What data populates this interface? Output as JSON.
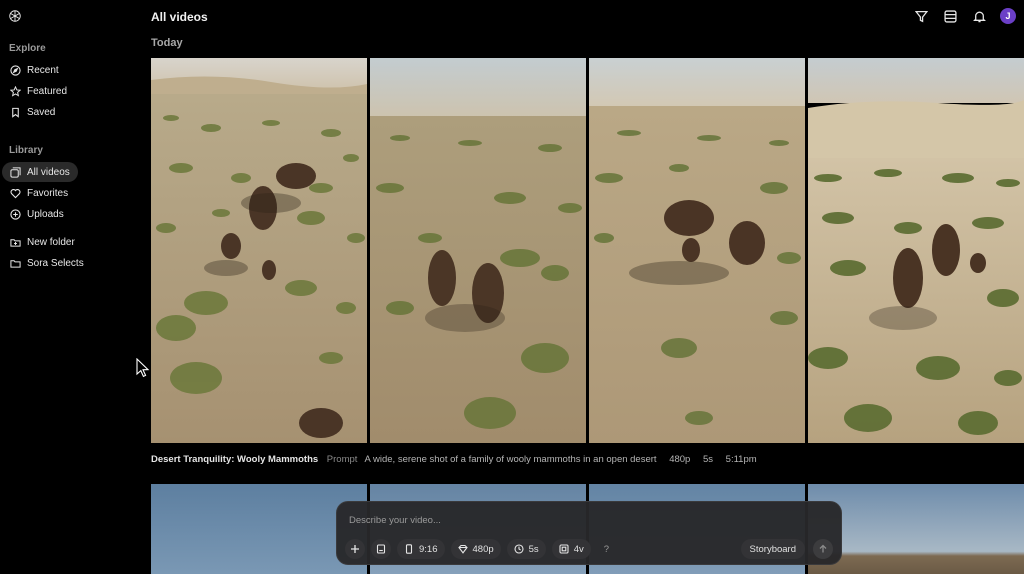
{
  "sidebar": {
    "explore_title": "Explore",
    "library_title": "Library",
    "explore_items": [
      {
        "label": "Recent",
        "icon": "compass-icon"
      },
      {
        "label": "Featured",
        "icon": "star-icon"
      },
      {
        "label": "Saved",
        "icon": "bookmark-icon"
      }
    ],
    "library_items": [
      {
        "label": "All videos",
        "icon": "videos-icon",
        "active": true
      },
      {
        "label": "Favorites",
        "icon": "heart-icon"
      },
      {
        "label": "Uploads",
        "icon": "upload-icon"
      }
    ],
    "folder_items": [
      {
        "label": "New folder",
        "icon": "new-folder-icon"
      },
      {
        "label": "Sora Selects",
        "icon": "folder-icon"
      }
    ]
  },
  "header": {
    "title": "All videos",
    "section": "Today",
    "avatar_initial": "J",
    "avatar_color": "#6b3fc7"
  },
  "video": {
    "title": "Desert Tranquility: Wooly Mammoths",
    "prompt_label": "Prompt",
    "prompt": "A wide, serene shot of a family of wooly mammoths in an open desert",
    "resolution": "480p",
    "duration": "5s",
    "time": "5:11pm"
  },
  "composer": {
    "placeholder": "Describe your video...",
    "aspect": "9:16",
    "resolution": "480p",
    "duration": "5s",
    "variations": "4v",
    "help": "?",
    "storyboard": "Storyboard"
  }
}
